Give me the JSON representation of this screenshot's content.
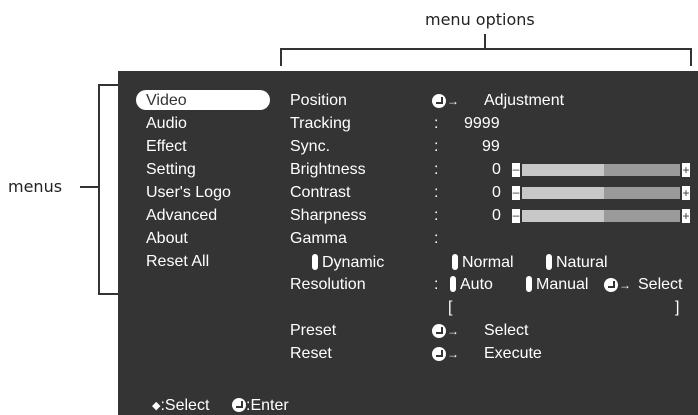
{
  "callouts": {
    "menu_options": "menu options",
    "menus": "menus"
  },
  "menus": [
    {
      "label": "Video",
      "active": true
    },
    {
      "label": "Audio"
    },
    {
      "label": "Effect"
    },
    {
      "label": "Setting"
    },
    {
      "label": "User's Logo"
    },
    {
      "label": "Advanced"
    },
    {
      "label": "About"
    },
    {
      "label": "Reset All"
    }
  ],
  "options": {
    "position": {
      "label": "Position",
      "action": "Adjustment"
    },
    "tracking": {
      "label": "Tracking",
      "sep": ":",
      "value": "9999"
    },
    "sync": {
      "label": "Sync.",
      "sep": ":",
      "value": "99"
    },
    "brightness": {
      "label": "Brightness",
      "sep": ":",
      "value": "0",
      "level": 0.5
    },
    "contrast": {
      "label": "Contrast",
      "sep": ":",
      "value": "0",
      "level": 0.5
    },
    "sharpness": {
      "label": "Sharpness",
      "sep": ":",
      "value": "0",
      "level": 0.5
    },
    "gamma": {
      "label": "Gamma",
      "sep": ":",
      "choices": [
        "Dynamic",
        "Normal",
        "Natural"
      ]
    },
    "resolution": {
      "label": "Resolution",
      "sep": ":",
      "choices": [
        "Auto",
        "Manual"
      ],
      "action": "Select",
      "bracket_open": "[",
      "bracket_close": "]"
    },
    "preset": {
      "label": "Preset",
      "action": "Select"
    },
    "reset": {
      "label": "Reset",
      "action": "Execute"
    }
  },
  "footer": {
    "select": ":Select",
    "enter": ":Enter"
  }
}
